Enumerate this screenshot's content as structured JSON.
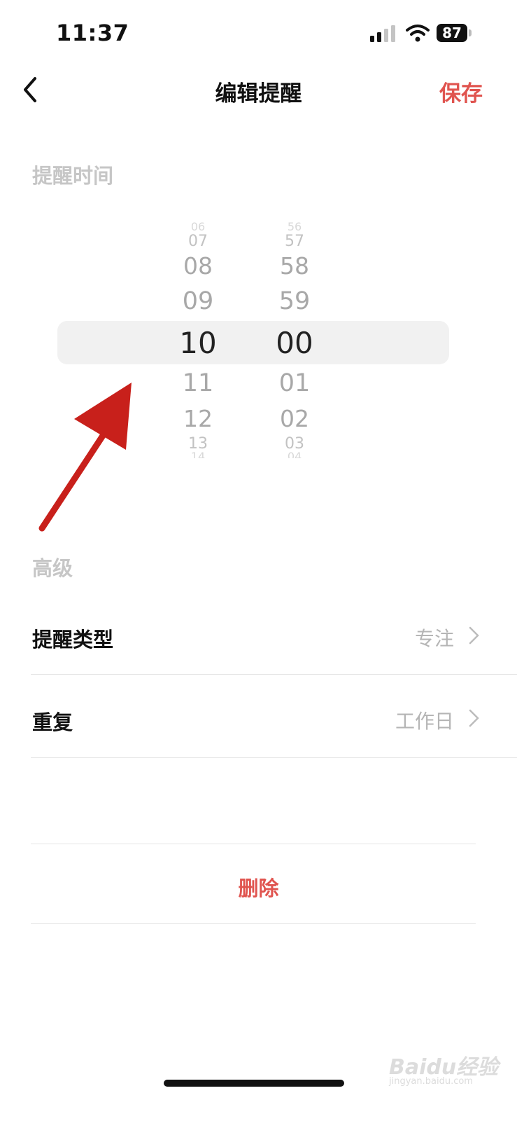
{
  "status_bar": {
    "time": "11:37",
    "battery": "87"
  },
  "nav": {
    "title": "编辑提醒",
    "save_label": "保存"
  },
  "reminder_time_section": "提醒时间",
  "picker": {
    "hours": [
      "06",
      "07",
      "08",
      "09",
      "10",
      "11",
      "12",
      "13",
      "14"
    ],
    "minutes": [
      "56",
      "57",
      "58",
      "59",
      "00",
      "01",
      "02",
      "03",
      "04"
    ],
    "selected_hour": "10",
    "selected_minute": "00"
  },
  "advanced_section": "高级",
  "rows": [
    {
      "label": "提醒类型",
      "value": "专注"
    },
    {
      "label": "重复",
      "value": "工作日"
    }
  ],
  "delete_label": "删除",
  "watermark": {
    "brand": "Baidu经验",
    "url": "jingyan.baidu.com"
  },
  "colors": {
    "accent": "#e0544f",
    "annotation_arrow": "#c8201b"
  }
}
